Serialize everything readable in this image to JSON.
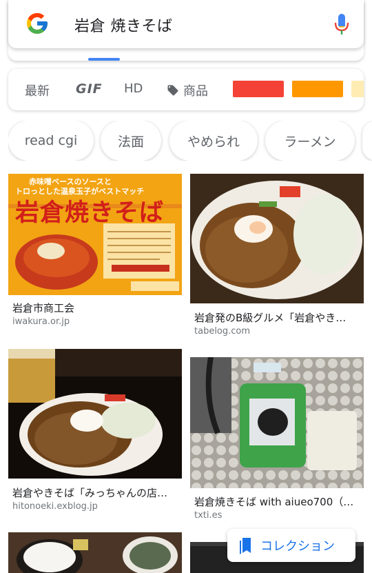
{
  "search": {
    "query": "岩倉 焼きそば",
    "logo_icon": "google-g-logo",
    "mic_icon": "microphone-icon"
  },
  "filters": {
    "latest": "最新",
    "gif": "GIF",
    "hd": "HD",
    "products": "商品",
    "products_icon": "tag-icon",
    "color_swatches": [
      "#f44336",
      "#ff9800",
      "#ffecb3"
    ]
  },
  "chips": [
    "read cgi",
    "法面",
    "やめられ",
    "ラーメン"
  ],
  "results": [
    {
      "title": "岩倉市商工会",
      "domain": "iwakura.or.jp",
      "poster_top": "赤味噌ベースのソースと",
      "poster_mid": "トロっとした温泉玉子がベストマッチ",
      "poster_title": "岩倉焼きそば"
    },
    {
      "title": "岩倉発のB級グルメ「岩倉やき…",
      "domain": "tabelog.com"
    },
    {
      "title": "岩倉やきそば「みっちゃんの店…",
      "domain": "hitonoeki.exblog.jp"
    },
    {
      "title": "岩倉焼きそば with aiueo700（…",
      "domain": "txti.es"
    }
  ],
  "collection": {
    "label": "コレクション",
    "icon": "bookmark-icon"
  }
}
